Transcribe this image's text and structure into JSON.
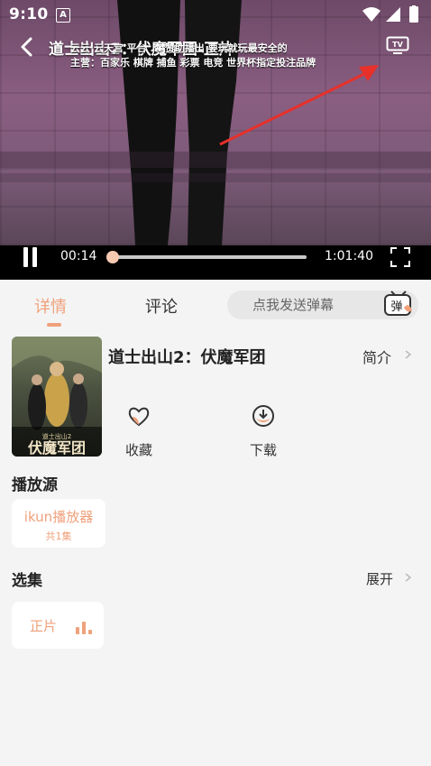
{
  "status_bar": {
    "time": "9:10",
    "notification_letter": "A"
  },
  "player": {
    "title": "道士出山2：伏魔军团-正片",
    "ticker_line1": "云云 云天宫 平台 ... 赞助播出 要玩就玩最安全的",
    "ticker_line2": "主营：百家乐 棋牌 捕鱼 彩票 电竞 世界杯指定投注品牌",
    "current_time": "00:14",
    "total_time": "1:01:40",
    "progress": 0.004,
    "accent_color": "#f0a17c"
  },
  "tabs": {
    "detail": "详情",
    "comment": "评论",
    "danmu_placeholder": "点我发送弹幕",
    "danmu_icon_text": "弹"
  },
  "movie": {
    "title": "道士出山2：伏魔军团",
    "intro_label": "简介",
    "poster_title_text": "伏魔军团",
    "poster_subtitle_text": "道士出山2"
  },
  "actions": {
    "favorite": "收藏",
    "download": "下载"
  },
  "source": {
    "section_title": "播放源",
    "name": "ikun播放器",
    "count": "共1集"
  },
  "episodes": {
    "section_title": "选集",
    "expand_label": "展开",
    "items": [
      "正片"
    ]
  }
}
